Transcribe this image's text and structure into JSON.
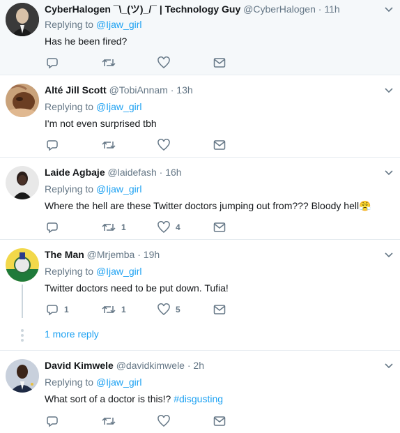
{
  "replying_label": "Replying to",
  "reply_target": "@Ijaw_girl",
  "more_replies_label": "1 more reply",
  "colors": {
    "accent": "#1da1f2",
    "muted": "#657786",
    "text": "#14171a",
    "border": "#e6ecf0"
  },
  "tweets": [
    {
      "name": "CyberHalogen ¯\\_(ツ)_/¯ | Technology Guy",
      "handle": "@CyberHalogen",
      "dot": "·",
      "time": "11h",
      "text": "Has he been fired?",
      "replies": "",
      "retweets": "",
      "likes": ""
    },
    {
      "name": "Alté Jill Scott",
      "handle": "@TobiAnnam",
      "dot": "·",
      "time": "13h",
      "text": "I'm not even surprised tbh",
      "replies": "",
      "retweets": "",
      "likes": ""
    },
    {
      "name": "Laide Agbaje",
      "handle": "@laidefash",
      "dot": "·",
      "time": "16h",
      "text": "Where the hell are these Twitter doctors jumping out from??? Bloody hell😤",
      "replies": "",
      "retweets": "1",
      "likes": "4"
    },
    {
      "name": "The Man",
      "handle": "@Mrjemba",
      "dot": "·",
      "time": "19h",
      "text": "Twitter doctors need to be put down. Tufia!",
      "replies": "1",
      "retweets": "1",
      "likes": "5"
    },
    {
      "name": "David Kimwele",
      "handle": "@davidkimwele",
      "dot": "·",
      "time": "2h",
      "text": "What sort of a doctor is this!?",
      "hashtag": "#disgusting",
      "replies": "",
      "retweets": "",
      "likes": ""
    }
  ]
}
